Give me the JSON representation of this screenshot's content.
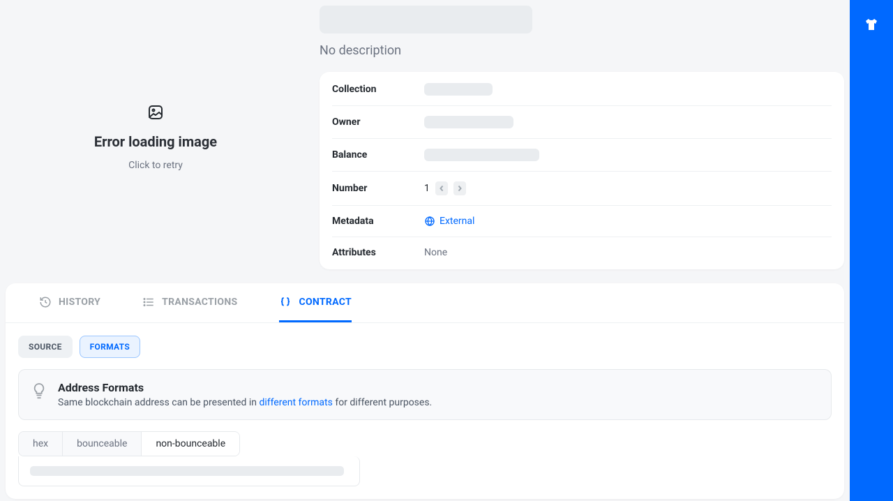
{
  "colors": {
    "accent": "#0069ff"
  },
  "image_error": {
    "title": "Error loading image",
    "subtitle": "Click to retry"
  },
  "description": "No description",
  "info": {
    "collection_label": "Collection",
    "owner_label": "Owner",
    "balance_label": "Balance",
    "number_label": "Number",
    "number_value": "1",
    "metadata_label": "Metadata",
    "metadata_link_text": "External",
    "attributes_label": "Attributes",
    "attributes_value": "None"
  },
  "tabs": {
    "history": "HISTORY",
    "transactions": "TRANSACTIONS",
    "contract": "CONTRACT"
  },
  "sub_tabs": {
    "source": "SOURCE",
    "formats": "FORMATS"
  },
  "notice": {
    "title": "Address Formats",
    "body_prefix": "Same blockchain address can be presented in ",
    "body_link": "different formats",
    "body_suffix": " for different purposes."
  },
  "format_tabs": {
    "hex": "hex",
    "bounceable": "bounceable",
    "non_bounceable": "non-bounceable"
  }
}
